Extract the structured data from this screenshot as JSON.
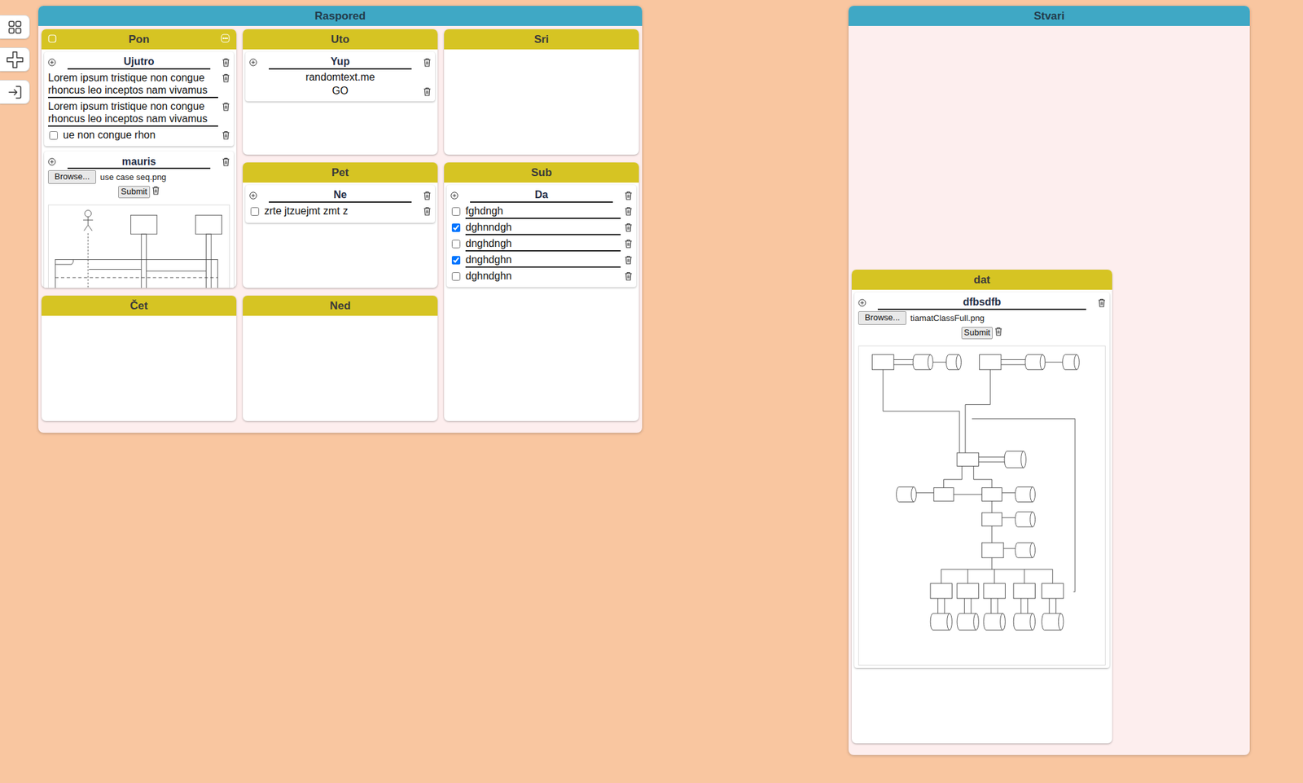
{
  "boards": [
    {
      "title": "Raspored",
      "columns": [
        {
          "title": "Pon",
          "menu": true,
          "lists": [
            {
              "title": "Ujutro",
              "items": [
                {
                  "kind": "text",
                  "text": "Lorem ipsum tristique non congue rhoncus leo inceptos nam vivamus"
                },
                {
                  "kind": "text",
                  "text": "Lorem ipsum tristique non congue rhoncus leo inceptos nam vivamus"
                },
                {
                  "kind": "checkbox",
                  "text": "ue non congue rhon",
                  "checked": false
                }
              ]
            },
            {
              "title": "mauris",
              "items": [
                {
                  "kind": "image",
                  "browse": "Browse...",
                  "file": "use case seq.png",
                  "submit": "Submit",
                  "preview": "sequence"
                }
              ]
            }
          ]
        },
        {
          "title": "Uto",
          "menu": false,
          "lists": [
            {
              "title": "Yup",
              "items": [
                {
                  "kind": "link",
                  "text": "randomtext.me",
                  "button": "GO"
                }
              ]
            }
          ]
        },
        {
          "title": "Sri",
          "menu": false,
          "lists": []
        },
        {
          "title": "Pet",
          "menu": false,
          "lists": [
            {
              "title": "Ne",
              "items": [
                {
                  "kind": "checkbox",
                  "text": "zrte jtzuejmt zmt z",
                  "checked": false
                }
              ]
            }
          ]
        },
        {
          "title": "Sub",
          "menu": false,
          "lists": [
            {
              "title": "Da",
              "items": [
                {
                  "kind": "checkbox",
                  "text": "fghdngh",
                  "checked": false
                },
                {
                  "kind": "checkbox",
                  "text": "dghnndgh",
                  "checked": true
                },
                {
                  "kind": "checkbox",
                  "text": "dnghdngh",
                  "checked": false
                },
                {
                  "kind": "checkbox",
                  "text": "dnghdghn",
                  "checked": true
                },
                {
                  "kind": "checkbox",
                  "text": "dghndghn",
                  "checked": false
                }
              ]
            }
          ]
        },
        {
          "title": "Čet",
          "menu": false,
          "lists": []
        },
        {
          "title": "Ned",
          "menu": false,
          "lists": []
        }
      ]
    },
    {
      "title": "Stvari",
      "columns": [
        {
          "title": "dat",
          "menu": false,
          "lists": [
            {
              "title": "dfbsdfb",
              "items": [
                {
                  "kind": "image",
                  "browse": "Browse...",
                  "file": "tiamatClassFull.png",
                  "submit": "Submit",
                  "preview": "flowchart"
                }
              ]
            }
          ]
        }
      ]
    }
  ]
}
